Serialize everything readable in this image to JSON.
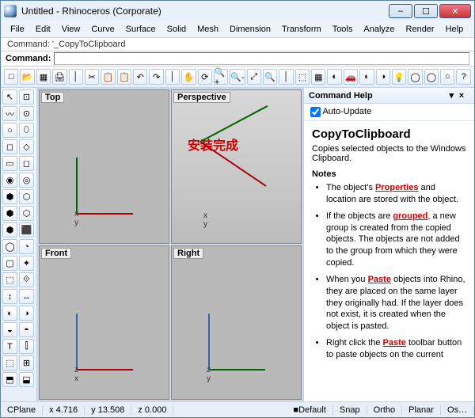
{
  "title": "Untitled - Rhinoceros (Corporate)",
  "menu": [
    "File",
    "Edit",
    "View",
    "Curve",
    "Surface",
    "Solid",
    "Mesh",
    "Dimension",
    "Transform",
    "Tools",
    "Analyze",
    "Render",
    "Help"
  ],
  "cmd_history": "Command: '_CopyToClipboard",
  "cmd_label": "Command:",
  "cmd_value": "",
  "viewports": {
    "tl": "Top",
    "tr": "Perspective",
    "bl": "Front",
    "br": "Right"
  },
  "annotation": "安装完成",
  "help": {
    "title": "Command Help",
    "auto_update": "Auto-Update",
    "cmd": "CopyToClipboard",
    "desc": "Copies selected objects to the Windows Clipboard.",
    "notes_label": "Notes",
    "notes": [
      {
        "pre": "The object's ",
        "kw": "Properties",
        "post": " and location are stored with the object."
      },
      {
        "pre": "If the objects are ",
        "kw": "grouped",
        "post": ", a new group is created from the copied objects. The objects are not added to the group from which they were copied."
      },
      {
        "pre": "When you ",
        "kw": "Paste",
        "post": " objects into Rhino, they are placed on the same layer they originally had. If the layer does not exist, it is created when the object is pasted."
      },
      {
        "pre": "Right click the ",
        "kw": "Paste",
        "post": " toolbar button to paste objects on the current"
      }
    ]
  },
  "status": {
    "cplane": "CPlane",
    "x": "x 4.716",
    "y": "y 13.508",
    "z": "z 0.000",
    "filter": "■Default",
    "snap": "Snap",
    "ortho": "Ortho",
    "planar": "Planar",
    "os": "Os…"
  }
}
